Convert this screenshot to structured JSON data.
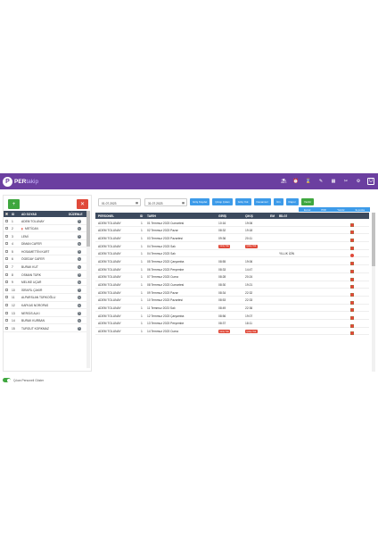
{
  "app": {
    "logo_mark": "P",
    "logo_text": "PER",
    "logo_text_2": "takip"
  },
  "topbar": {
    "icons": [
      "vacation-icon",
      "alarm-icon",
      "hourglass-icon",
      "edit-icon",
      "calendar-icon",
      "tools-icon",
      "settings-icon"
    ],
    "user": "U"
  },
  "left": {
    "add_label": "+",
    "remove_label": "✕",
    "headers": {
      "id": "ID",
      "name": "AD SOYAD",
      "edit": "DÜZENLE"
    },
    "rows": [
      {
        "id": "1",
        "name": "ADEM TOLUNAY"
      },
      {
        "id": "2",
        "name": "METİCAN",
        "flag": true
      },
      {
        "id": "3",
        "name": "LEMİ"
      },
      {
        "id": "4",
        "name": "DİMAN CAFER"
      },
      {
        "id": "5",
        "name": "HOSAMETTİN KURT"
      },
      {
        "id": "6",
        "name": "ÖGEDAY CAFER"
      },
      {
        "id": "7",
        "name": "BURAK KUT"
      },
      {
        "id": "8",
        "name": "OSMAN TÜRK"
      },
      {
        "id": "9",
        "name": "MELİKE UÇAR"
      },
      {
        "id": "10",
        "name": "İSRAFİL ÇAKIR"
      },
      {
        "id": "11",
        "name": "ALPARSLAN TÜRKOĞLU"
      },
      {
        "id": "12",
        "name": "KAFKAS NOROPAS"
      },
      {
        "id": "13",
        "name": "NERGİS ALKI"
      },
      {
        "id": "14",
        "name": "BURAK KURBAN"
      },
      {
        "id": "15",
        "name": "TURGUT KORKMAZ"
      }
    ]
  },
  "main": {
    "date_start": "01.07.2023",
    "date_end": "31.07.2023",
    "buttons": [
      "Giriş Kaydet",
      "Çıkışı Çıkan",
      "Giriş Yok",
      "Devamsız",
      "İzin",
      "Rapor",
      "Yazdır"
    ],
    "exports": [
      "Excel",
      "PDF",
      "Yazdır",
      "E-posta"
    ],
    "headers": {
      "personel": "PERSONEL",
      "id": "ID",
      "tarih": "TARİH",
      "giris": "GİRİŞ",
      "cikis": "ÇIKIŞ",
      "em": "EM",
      "bilgi": "BİLGİ"
    },
    "rows": [
      {
        "p": "ADEM TOLUNAY",
        "id": "1",
        "t": "01 Temmuz 2023 Cumartesi",
        "g": "10:16",
        "c": "19:06",
        "b": ""
      },
      {
        "p": "ADEM TOLUNAY",
        "id": "1",
        "t": "02 Temmuz 2023 Pazar",
        "g": "08:32",
        "c": "19:18",
        "b": ""
      },
      {
        "p": "ADEM TOLUNAY",
        "id": "1",
        "t": "03 Temmuz 2023 Pazartesi",
        "g": "09:36",
        "c": "20:11",
        "b": ""
      },
      {
        "p": "ADEM TOLUNAY",
        "id": "1",
        "t": "04 Temmuz 2023 Salı",
        "g": "Giriş Yok",
        "c": "Çıkış Yok",
        "gr": true,
        "cr": true,
        "b": ""
      },
      {
        "p": "ADEM TOLUNAY",
        "id": "1",
        "t": "04 Temmuz 2023 Salı",
        "g": "",
        "c": "",
        "b": "YILLIK İZİN",
        "only_del": true
      },
      {
        "p": "ADEM TOLUNAY",
        "id": "1",
        "t": "05 Temmuz 2023 Çarşamba",
        "g": "08:55",
        "c": "19:06",
        "b": ""
      },
      {
        "p": "ADEM TOLUNAY",
        "id": "1",
        "t": "06 Temmuz 2023 Perşembe",
        "g": "08:33",
        "c": "14:47",
        "b": ""
      },
      {
        "p": "ADEM TOLUNAY",
        "id": "1",
        "t": "07 Temmuz 2023 Cuma",
        "g": "08:28",
        "c": "20:24",
        "b": ""
      },
      {
        "p": "ADEM TOLUNAY",
        "id": "1",
        "t": "08 Temmuz 2023 Cumartesi",
        "g": "08:30",
        "c": "19:21",
        "b": ""
      },
      {
        "p": "ADEM TOLUNAY",
        "id": "1",
        "t": "09 Temmuz 2023 Pazar",
        "g": "08:34",
        "c": "22:32",
        "b": ""
      },
      {
        "p": "ADEM TOLUNAY",
        "id": "1",
        "t": "10 Temmuz 2023 Pazartesi",
        "g": "08:53",
        "c": "22:33",
        "b": ""
      },
      {
        "p": "ADEM TOLUNAY",
        "id": "1",
        "t": "11 Temmuz 2023 Salı",
        "g": "08:49",
        "c": "22:36",
        "b": ""
      },
      {
        "p": "ADEM TOLUNAY",
        "id": "1",
        "t": "12 Temmuz 2023 Çarşamba",
        "g": "08:56",
        "c": "19:07",
        "b": ""
      },
      {
        "p": "ADEM TOLUNAY",
        "id": "1",
        "t": "13 Temmuz 2023 Perşembe",
        "g": "08:37",
        "c": "18:11",
        "b": ""
      },
      {
        "p": "ADEM TOLUNAY",
        "id": "1",
        "t": "14 Temmuz 2023 Cuma",
        "g": "Giriş Yok",
        "c": "Çıkış Yok",
        "gr": true,
        "cr": true,
        "b": ""
      }
    ]
  },
  "footer": {
    "label": "Çıkan Personeli Göster"
  },
  "colors": {
    "brand": "#6b3fa0",
    "header": "#3c4a5e",
    "accent": "#3d9be9",
    "danger": "#e04a3a",
    "success": "#3fa73f"
  }
}
